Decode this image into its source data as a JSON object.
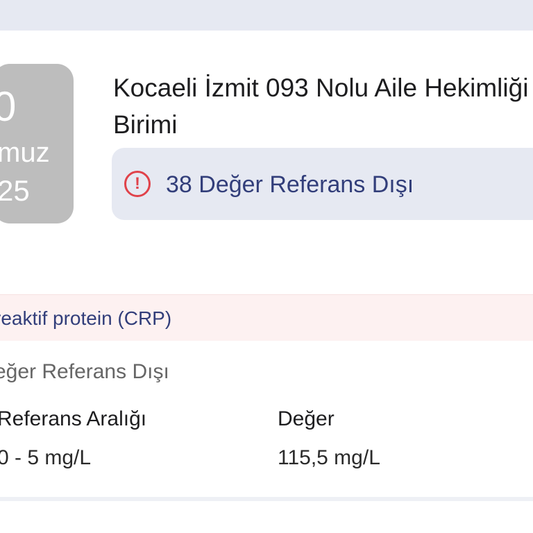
{
  "date": {
    "day": "0",
    "month": "muz",
    "year": "25"
  },
  "unit": {
    "title": "Kocaeli İzmit 093 Nolu Aile Hekimliği Birimi"
  },
  "alert": {
    "icon": "exclamation-circle-icon",
    "text": "38 Değer Referans Dışı",
    "color": "#e0424a"
  },
  "test": {
    "name": "reaktif protein (CRP)",
    "status": "eğer Referans Dışı",
    "reference_label": "Referans Aralığı",
    "reference_value": "0 - 5 mg/L",
    "value_label": "Değer",
    "value": "115,5 mg/L"
  },
  "colors": {
    "accent_text": "#323e7a",
    "alert_bg": "#e6e9f2",
    "test_header_bg": "#fdf1f1",
    "date_tile_bg": "#bdbdbd"
  }
}
